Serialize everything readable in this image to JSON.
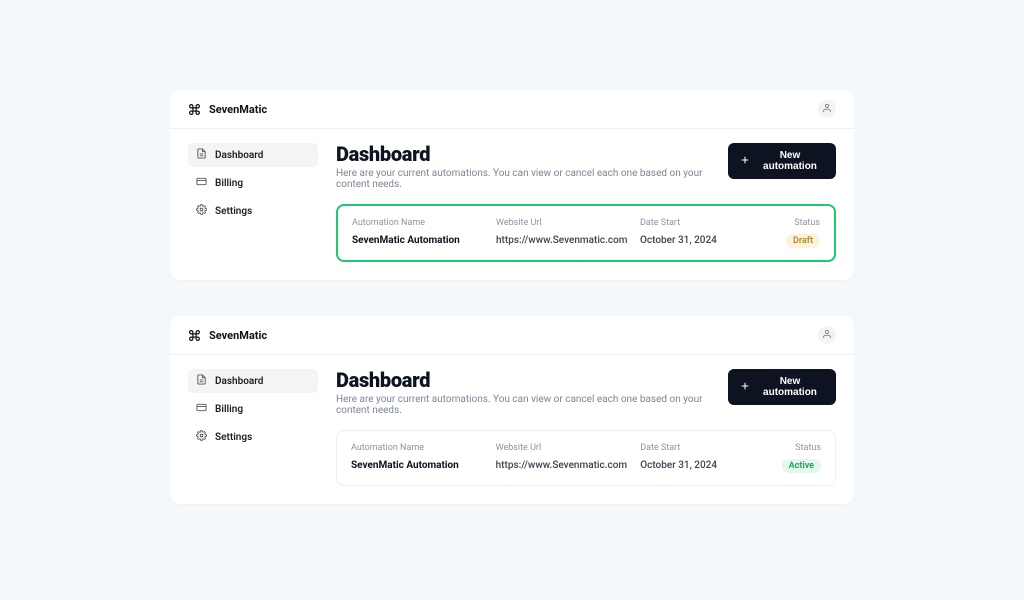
{
  "brand": "SevenMatic",
  "sidebar": {
    "items": [
      {
        "label": "Dashboard"
      },
      {
        "label": "Billing"
      },
      {
        "label": "Settings"
      }
    ]
  },
  "header": {
    "title": "Dashboard",
    "subtitle": "Here are your current automations. You can view or cancel each one based on your content needs.",
    "new_button": "New automation"
  },
  "columns": {
    "name": "Automation Name",
    "url": "Website Url",
    "date": "Date Start",
    "status": "Status"
  },
  "cards": [
    {
      "name": "SevenMatic Automation",
      "url": "https://www.Sevenmatic.com",
      "date": "October 31, 2024",
      "status": "Draft",
      "highlight": true
    },
    {
      "name": "SevenMatic Automation",
      "url": "https://www.Sevenmatic.com",
      "date": "October 31, 2024",
      "status": "Active",
      "highlight": false
    }
  ]
}
